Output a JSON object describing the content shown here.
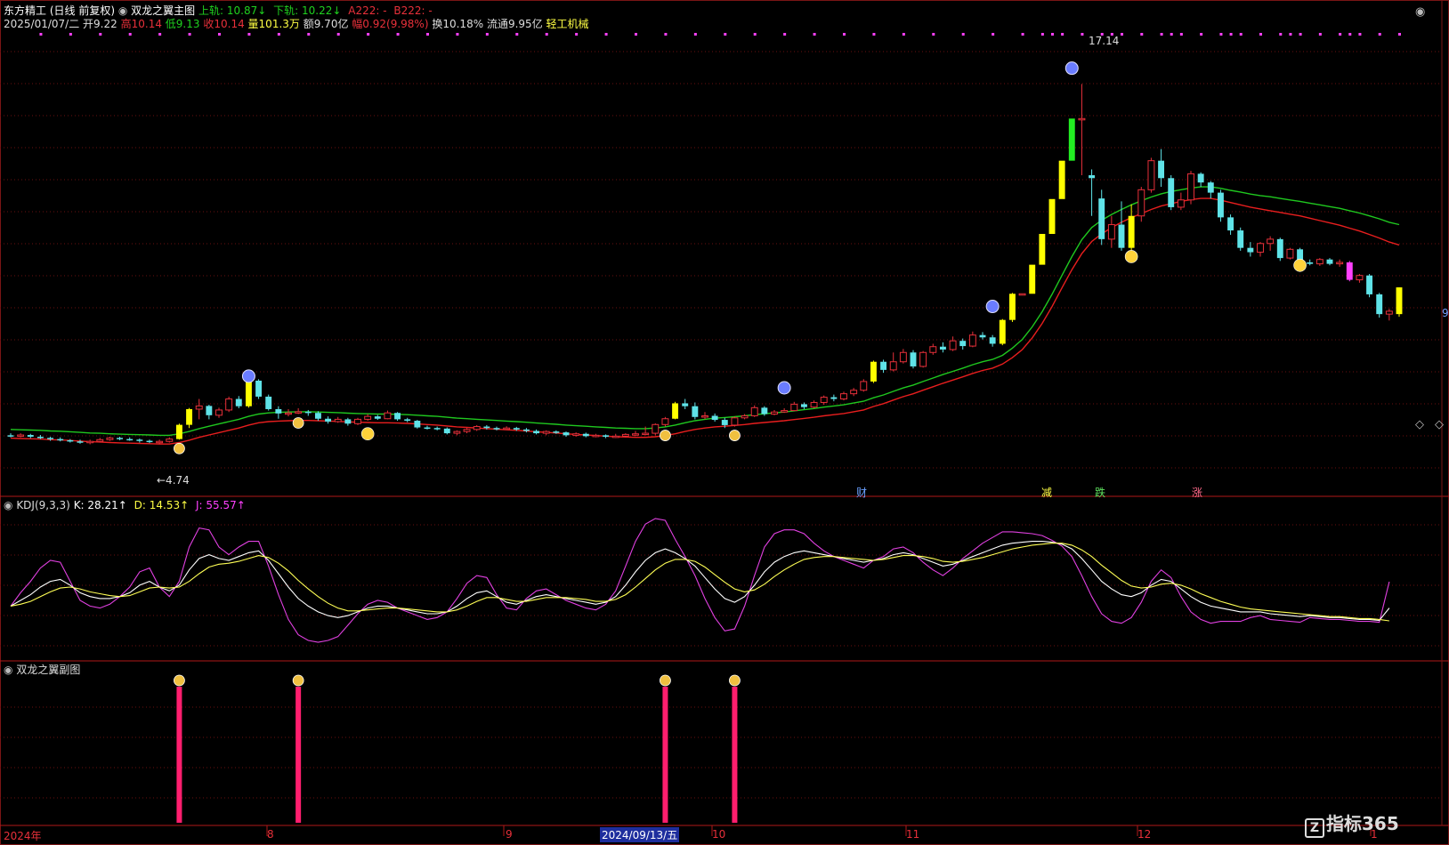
{
  "header": {
    "stock_name": "东方精工",
    "period": "(日线 前复权)",
    "indicator": "双龙之翼主图",
    "upper_label": "上轨: 10.87↓",
    "lower_label": "下轨: 10.22↓",
    "a_label": "A222: -",
    "b_label": "B222: -",
    "date": "2025/01/07/二",
    "open": "开9.22",
    "high": "高10.14",
    "low": "低9.13",
    "close": "收10.14",
    "volume": "量101.3万",
    "amount": "额9.70亿",
    "change": "幅0.92(9.98%)",
    "turnover": "换10.18%",
    "float": "流通9.95亿",
    "sector": "轻工机械"
  },
  "annotations": {
    "peak_label": "17.14",
    "low_label": "←4.74",
    "bottom_tags": [
      "财",
      "减",
      "跌",
      "涨"
    ],
    "right_price": "9"
  },
  "kdj": {
    "title": "KDJ(9,3,3)",
    "k_label": "K: 28.21↑",
    "d_label": "D: 14.53↑",
    "j_label": "J: 55.57↑"
  },
  "sub": {
    "title": "双龙之翼副图"
  },
  "xaxis": {
    "labels": [
      "2024年",
      "8",
      "9",
      "2024/09/13/五",
      "10",
      "11",
      "12",
      "1"
    ]
  },
  "logo": {
    "mark": "Z",
    "text": "指标365"
  },
  "colors": {
    "up": "#e8303a",
    "down": "#5fe3e8",
    "yellow": "#ffff00",
    "green_band": "#1fc81f",
    "red_band": "#e81e1e",
    "magenta": "#ff40ff",
    "kline": "#ffffff",
    "dline": "#ffff55",
    "jline": "#e040e0",
    "grid": "#6a1010",
    "sub_bar": "#ff1e6e"
  },
  "chart_data": {
    "type": "candlestick",
    "price_ylim": [
      3.5,
      18.5
    ],
    "bars": [
      [
        5.05,
        5.02,
        5.12,
        4.98
      ],
      [
        5.02,
        5.06,
        5.12,
        4.98
      ],
      [
        5.06,
        5.0,
        5.1,
        4.95
      ],
      [
        5.0,
        4.96,
        5.06,
        4.92
      ],
      [
        4.96,
        4.92,
        5.0,
        4.86
      ],
      [
        4.92,
        4.88,
        4.98,
        4.84
      ],
      [
        4.88,
        4.84,
        4.92,
        4.8
      ],
      [
        4.84,
        4.8,
        4.9,
        4.76
      ],
      [
        4.8,
        4.84,
        4.9,
        4.74
      ],
      [
        4.84,
        4.9,
        4.96,
        4.8
      ],
      [
        4.9,
        4.96,
        5.0,
        4.86
      ],
      [
        4.96,
        4.92,
        5.0,
        4.88
      ],
      [
        4.92,
        4.9,
        4.98,
        4.86
      ],
      [
        4.9,
        4.86,
        4.94,
        4.8
      ],
      [
        4.86,
        4.82,
        4.9,
        4.78
      ],
      [
        4.82,
        4.84,
        4.9,
        4.74
      ],
      [
        4.84,
        4.92,
        4.98,
        4.8
      ],
      [
        4.92,
        5.41,
        5.45,
        4.9
      ],
      [
        5.41,
        5.95,
        5.99,
        5.3
      ],
      [
        5.95,
        6.06,
        6.3,
        5.6
      ],
      [
        6.06,
        5.74,
        6.1,
        5.6
      ],
      [
        5.74,
        5.92,
        6.0,
        5.65
      ],
      [
        5.92,
        6.3,
        6.38,
        5.85
      ],
      [
        6.3,
        6.05,
        6.4,
        5.98
      ],
      [
        6.05,
        6.93,
        6.95,
        6.0
      ],
      [
        6.93,
        6.38,
        6.98,
        6.3
      ],
      [
        6.38,
        5.95,
        6.45,
        5.9
      ],
      [
        5.95,
        5.8,
        6.05,
        5.62
      ],
      [
        5.8,
        5.82,
        5.95,
        5.7
      ],
      [
        5.82,
        5.86,
        5.98,
        5.78
      ],
      [
        5.86,
        5.82,
        5.92,
        5.72
      ],
      [
        5.82,
        5.62,
        5.88,
        5.55
      ],
      [
        5.62,
        5.52,
        5.7,
        5.45
      ],
      [
        5.52,
        5.6,
        5.68,
        5.48
      ],
      [
        5.6,
        5.45,
        5.65,
        5.38
      ],
      [
        5.45,
        5.6,
        5.65,
        5.4
      ],
      [
        5.6,
        5.7,
        5.78,
        5.55
      ],
      [
        5.7,
        5.62,
        5.75,
        5.58
      ],
      [
        5.62,
        5.82,
        5.9,
        5.6
      ],
      [
        5.82,
        5.6,
        5.85,
        5.55
      ],
      [
        5.6,
        5.55,
        5.65,
        5.5
      ],
      [
        5.55,
        5.32,
        5.58,
        5.28
      ],
      [
        5.32,
        5.3,
        5.38,
        5.25
      ],
      [
        5.3,
        5.28,
        5.35,
        5.22
      ],
      [
        5.28,
        5.12,
        5.32,
        5.08
      ],
      [
        5.12,
        5.18,
        5.22,
        5.05
      ],
      [
        5.18,
        5.25,
        5.3,
        5.12
      ],
      [
        5.25,
        5.35,
        5.4,
        5.2
      ],
      [
        5.35,
        5.3,
        5.4,
        5.25
      ],
      [
        5.3,
        5.28,
        5.35,
        5.22
      ],
      [
        5.28,
        5.3,
        5.36,
        5.24
      ],
      [
        5.3,
        5.25,
        5.34,
        5.2
      ],
      [
        5.25,
        5.2,
        5.3,
        5.15
      ],
      [
        5.2,
        5.12,
        5.25,
        5.08
      ],
      [
        5.12,
        5.18,
        5.22,
        5.05
      ],
      [
        5.18,
        5.15,
        5.22,
        5.1
      ],
      [
        5.15,
        5.05,
        5.18,
        5.0
      ],
      [
        5.05,
        5.1,
        5.15,
        5.0
      ],
      [
        5.1,
        5.02,
        5.14,
        4.98
      ],
      [
        5.02,
        5.05,
        5.1,
        4.98
      ],
      [
        5.05,
        5.0,
        5.08,
        4.95
      ],
      [
        5.0,
        5.02,
        5.1,
        4.96
      ],
      [
        5.02,
        5.08,
        5.12,
        4.98
      ],
      [
        5.08,
        5.1,
        5.2,
        5.02
      ],
      [
        5.1,
        5.12,
        5.35,
        5.05
      ],
      [
        5.12,
        5.42,
        5.46,
        5.05
      ],
      [
        5.42,
        5.62,
        5.68,
        5.35
      ],
      [
        5.62,
        6.15,
        6.2,
        5.6
      ],
      [
        6.15,
        6.05,
        6.3,
        5.95
      ],
      [
        6.05,
        5.68,
        6.18,
        5.6
      ],
      [
        5.68,
        5.72,
        5.85,
        5.6
      ],
      [
        5.72,
        5.58,
        5.8,
        5.52
      ],
      [
        5.58,
        5.4,
        5.65,
        5.3
      ],
      [
        5.4,
        5.65,
        5.7,
        5.35
      ],
      [
        5.65,
        5.72,
        5.78,
        5.6
      ],
      [
        5.72,
        6.0,
        6.08,
        5.68
      ],
      [
        6.0,
        5.78,
        6.05,
        5.72
      ],
      [
        5.78,
        5.85,
        5.92,
        5.74
      ],
      [
        5.85,
        5.9,
        5.98,
        5.82
      ],
      [
        5.9,
        6.12,
        6.2,
        5.88
      ],
      [
        6.12,
        6.02,
        6.18,
        5.95
      ],
      [
        6.02,
        6.18,
        6.25,
        5.98
      ],
      [
        6.18,
        6.36,
        6.42,
        6.1
      ],
      [
        6.36,
        6.3,
        6.45,
        6.22
      ],
      [
        6.3,
        6.48,
        6.55,
        6.25
      ],
      [
        6.48,
        6.6,
        6.68,
        6.4
      ],
      [
        6.6,
        6.9,
        6.98,
        6.55
      ],
      [
        6.9,
        7.58,
        7.62,
        6.85
      ],
      [
        7.58,
        7.3,
        7.65,
        7.2
      ],
      [
        7.3,
        7.58,
        7.9,
        7.25
      ],
      [
        7.58,
        7.9,
        8.02,
        7.52
      ],
      [
        7.9,
        7.42,
        7.98,
        7.35
      ],
      [
        7.42,
        7.9,
        7.95,
        7.38
      ],
      [
        7.9,
        8.1,
        8.2,
        7.82
      ],
      [
        8.1,
        8.0,
        8.25,
        7.9
      ],
      [
        8.0,
        8.3,
        8.45,
        7.95
      ],
      [
        8.3,
        8.12,
        8.38,
        8.0
      ],
      [
        8.12,
        8.5,
        8.62,
        8.08
      ],
      [
        8.5,
        8.42,
        8.6,
        8.35
      ],
      [
        8.42,
        8.2,
        8.5,
        8.1
      ],
      [
        8.2,
        9.02,
        9.05,
        8.15
      ],
      [
        9.02,
        9.92,
        9.95,
        8.95
      ],
      [
        9.92,
        9.92,
        9.92,
        9.92
      ],
      [
        9.92,
        10.92,
        10.92,
        10.92
      ],
      [
        10.92,
        11.98,
        11.98,
        11.98
      ],
      [
        11.98,
        13.18,
        13.18,
        13.18
      ],
      [
        13.18,
        14.5,
        14.5,
        14.5
      ],
      [
        14.5,
        15.95,
        15.95,
        15.95
      ],
      [
        15.95,
        15.95,
        17.14,
        14.0
      ],
      [
        14.0,
        13.9,
        14.2,
        12.6
      ],
      [
        13.2,
        11.8,
        13.5,
        11.6
      ],
      [
        11.8,
        12.3,
        12.6,
        11.5
      ],
      [
        12.3,
        11.5,
        13.1,
        11.4
      ],
      [
        11.5,
        12.6,
        13.0,
        11.4
      ],
      [
        12.6,
        13.5,
        13.6,
        12.4
      ],
      [
        13.5,
        14.5,
        14.6,
        13.4
      ],
      [
        14.5,
        13.9,
        14.9,
        13.6
      ],
      [
        13.9,
        12.9,
        14.0,
        12.8
      ],
      [
        12.9,
        13.15,
        13.4,
        12.8
      ],
      [
        13.15,
        14.05,
        14.15,
        13.0
      ],
      [
        14.05,
        13.75,
        14.1,
        13.6
      ],
      [
        13.75,
        13.4,
        13.8,
        13.2
      ],
      [
        13.4,
        12.55,
        13.5,
        12.4
      ],
      [
        12.55,
        12.1,
        12.65,
        11.95
      ],
      [
        12.1,
        11.5,
        12.2,
        11.4
      ],
      [
        11.5,
        11.35,
        11.7,
        11.2
      ],
      [
        11.35,
        11.65,
        11.7,
        11.2
      ],
      [
        11.65,
        11.8,
        11.9,
        11.4
      ],
      [
        11.8,
        11.15,
        11.85,
        11.05
      ],
      [
        11.15,
        11.45,
        11.5,
        11.1
      ],
      [
        11.45,
        11.0,
        11.5,
        10.95
      ],
      [
        11.0,
        10.95,
        11.1,
        10.9
      ],
      [
        10.95,
        11.1,
        11.15,
        10.88
      ],
      [
        11.1,
        10.95,
        11.15,
        10.9
      ],
      [
        10.95,
        11.0,
        11.1,
        10.85
      ],
      [
        11.0,
        10.4,
        11.05,
        10.35
      ],
      [
        10.4,
        10.55,
        10.6,
        10.3
      ],
      [
        10.55,
        9.9,
        10.6,
        9.8
      ],
      [
        9.9,
        9.22,
        9.95,
        9.1
      ],
      [
        9.22,
        9.32,
        9.4,
        9.0
      ],
      [
        9.22,
        10.14,
        10.14,
        9.13
      ]
    ],
    "upper_band": [
      5.25,
      5.24,
      5.23,
      5.22,
      5.2,
      5.19,
      5.17,
      5.15,
      5.13,
      5.12,
      5.1,
      5.09,
      5.08,
      5.07,
      5.06,
      5.05,
      5.05,
      5.1,
      5.18,
      5.28,
      5.36,
      5.44,
      5.52,
      5.6,
      5.7,
      5.78,
      5.82,
      5.84,
      5.85,
      5.86,
      5.86,
      5.85,
      5.84,
      5.83,
      5.81,
      5.8,
      5.79,
      5.78,
      5.78,
      5.77,
      5.76,
      5.74,
      5.72,
      5.7,
      5.67,
      5.64,
      5.62,
      5.6,
      5.58,
      5.56,
      5.54,
      5.52,
      5.5,
      5.47,
      5.45,
      5.43,
      5.4,
      5.38,
      5.36,
      5.34,
      5.32,
      5.3,
      5.29,
      5.28,
      5.28,
      5.3,
      5.34,
      5.4,
      5.48,
      5.55,
      5.6,
      5.64,
      5.66,
      5.69,
      5.72,
      5.76,
      5.79,
      5.82,
      5.85,
      5.89,
      5.93,
      5.97,
      6.02,
      6.06,
      6.1,
      6.16,
      6.22,
      6.34,
      6.44,
      6.56,
      6.68,
      6.78,
      6.9,
      7.02,
      7.14,
      7.25,
      7.36,
      7.48,
      7.58,
      7.66,
      7.8,
      8.05,
      8.35,
      8.78,
      9.3,
      9.9,
      10.55,
      11.2,
      11.78,
      12.2,
      12.45,
      12.65,
      12.82,
      12.98,
      13.12,
      13.25,
      13.36,
      13.44,
      13.5,
      13.56,
      13.6,
      13.6,
      13.55,
      13.48,
      13.42,
      13.35,
      13.3,
      13.26,
      13.2,
      13.15,
      13.1,
      13.04,
      12.98,
      12.92,
      12.86,
      12.78,
      12.7,
      12.6,
      12.5,
      12.38,
      12.3
    ],
    "lower_band": [
      4.95,
      4.94,
      4.93,
      4.92,
      4.9,
      4.89,
      4.87,
      4.85,
      4.83,
      4.82,
      4.8,
      4.79,
      4.78,
      4.77,
      4.76,
      4.75,
      4.75,
      4.8,
      4.88,
      4.98,
      5.06,
      5.14,
      5.22,
      5.3,
      5.4,
      5.48,
      5.52,
      5.54,
      5.55,
      5.56,
      5.56,
      5.55,
      5.54,
      5.53,
      5.51,
      5.5,
      5.49,
      5.48,
      5.48,
      5.47,
      5.46,
      5.44,
      5.42,
      5.4,
      5.37,
      5.34,
      5.32,
      5.3,
      5.28,
      5.26,
      5.24,
      5.22,
      5.2,
      5.17,
      5.15,
      5.13,
      5.1,
      5.08,
      5.06,
      5.04,
      5.02,
      5.0,
      4.99,
      4.98,
      4.98,
      5.0,
      5.04,
      5.1,
      5.18,
      5.25,
      5.3,
      5.34,
      5.36,
      5.39,
      5.42,
      5.46,
      5.49,
      5.52,
      5.55,
      5.59,
      5.63,
      5.67,
      5.72,
      5.76,
      5.8,
      5.86,
      5.92,
      6.04,
      6.14,
      6.26,
      6.38,
      6.48,
      6.6,
      6.72,
      6.84,
      6.95,
      7.06,
      7.18,
      7.28,
      7.36,
      7.5,
      7.72,
      8.0,
      8.4,
      8.9,
      9.48,
      10.12,
      10.75,
      11.3,
      11.72,
      11.98,
      12.2,
      12.38,
      12.54,
      12.68,
      12.82,
      12.94,
      13.02,
      13.1,
      13.16,
      13.2,
      13.2,
      13.14,
      13.06,
      12.98,
      12.9,
      12.84,
      12.78,
      12.72,
      12.66,
      12.6,
      12.52,
      12.44,
      12.36,
      12.28,
      12.18,
      12.08,
      11.96,
      11.84,
      11.7,
      11.6
    ],
    "kdj_ylim": [
      -20,
      120
    ],
    "K": [
      30,
      36,
      42,
      50,
      56,
      58,
      52,
      44,
      40,
      38,
      38,
      40,
      44,
      52,
      56,
      50,
      46,
      52,
      68,
      80,
      84,
      80,
      78,
      82,
      86,
      88,
      78,
      64,
      50,
      38,
      30,
      24,
      20,
      18,
      20,
      24,
      28,
      30,
      30,
      28,
      26,
      24,
      22,
      22,
      24,
      30,
      38,
      44,
      46,
      40,
      34,
      32,
      36,
      40,
      42,
      40,
      38,
      36,
      34,
      32,
      34,
      40,
      52,
      66,
      78,
      86,
      90,
      86,
      80,
      72,
      60,
      48,
      38,
      34,
      40,
      52,
      66,
      76,
      82,
      86,
      88,
      86,
      84,
      82,
      80,
      78,
      76,
      78,
      80,
      84,
      86,
      84,
      80,
      76,
      72,
      74,
      78,
      82,
      86,
      90,
      94,
      96,
      97,
      98,
      98,
      97,
      95,
      90,
      80,
      68,
      56,
      48,
      42,
      40,
      44,
      52,
      58,
      56,
      48,
      40,
      34,
      30,
      28,
      26,
      24,
      24,
      24,
      22,
      21,
      20,
      19,
      20,
      19,
      18,
      18,
      17,
      16,
      16,
      15,
      28
    ],
    "D": [
      30,
      32,
      35,
      40,
      45,
      49,
      50,
      48,
      45,
      43,
      41,
      40,
      41,
      45,
      49,
      50,
      49,
      50,
      56,
      64,
      71,
      74,
      75,
      77,
      80,
      83,
      81,
      75,
      67,
      57,
      48,
      40,
      33,
      28,
      25,
      25,
      26,
      27,
      28,
      28,
      27,
      26,
      25,
      24,
      24,
      26,
      30,
      35,
      39,
      39,
      37,
      35,
      35,
      37,
      39,
      39,
      39,
      38,
      37,
      35,
      35,
      37,
      42,
      50,
      59,
      68,
      75,
      79,
      79,
      77,
      71,
      63,
      55,
      48,
      45,
      47,
      53,
      61,
      68,
      74,
      79,
      81,
      82,
      82,
      81,
      80,
      79,
      78,
      79,
      81,
      83,
      83,
      82,
      80,
      77,
      76,
      77,
      79,
      81,
      84,
      87,
      90,
      92,
      94,
      95,
      96,
      96,
      94,
      89,
      82,
      73,
      65,
      57,
      51,
      49,
      50,
      53,
      54,
      52,
      48,
      43,
      39,
      35,
      32,
      29,
      27,
      26,
      25,
      24,
      23,
      22,
      21,
      20,
      19,
      19,
      18,
      17,
      17,
      16,
      14.5
    ],
    "J": [
      30,
      44,
      56,
      70,
      78,
      76,
      56,
      36,
      30,
      28,
      32,
      40,
      50,
      66,
      70,
      50,
      40,
      56,
      92,
      112,
      110,
      92,
      84,
      92,
      98,
      98,
      72,
      42,
      16,
      0,
      -6,
      -8,
      -6,
      -2,
      10,
      22,
      32,
      36,
      34,
      28,
      24,
      20,
      16,
      18,
      24,
      38,
      54,
      62,
      60,
      42,
      28,
      26,
      38,
      46,
      48,
      42,
      36,
      32,
      28,
      26,
      32,
      46,
      72,
      98,
      116,
      122,
      120,
      100,
      82,
      62,
      38,
      18,
      4,
      6,
      30,
      62,
      92,
      106,
      110,
      110,
      106,
      96,
      88,
      82,
      78,
      74,
      70,
      78,
      82,
      90,
      92,
      86,
      76,
      68,
      62,
      70,
      80,
      88,
      96,
      102,
      108,
      108,
      107,
      106,
      104,
      99,
      93,
      82,
      62,
      40,
      22,
      14,
      12,
      18,
      34,
      56,
      68,
      60,
      40,
      24,
      16,
      12,
      14,
      14,
      14,
      18,
      20,
      16,
      15,
      14,
      13,
      18,
      17,
      16,
      16,
      15,
      14,
      14,
      13,
      55.57
    ],
    "sub_signals": [
      17,
      29,
      66,
      73
    ]
  }
}
